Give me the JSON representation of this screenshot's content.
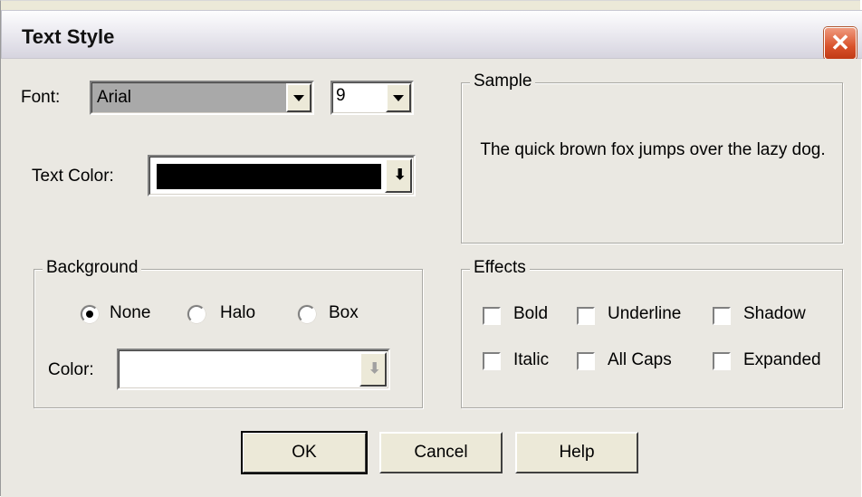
{
  "window": {
    "title": "Text Style",
    "close_glyph": "✕"
  },
  "font": {
    "label": "Font:",
    "value": "Arial",
    "size_value": "9"
  },
  "text_color": {
    "label": "Text Color:",
    "value_color": "#000000"
  },
  "sample": {
    "title": "Sample",
    "text": "The quick brown fox jumps over the lazy dog."
  },
  "background": {
    "title": "Background",
    "options": [
      "None",
      "Halo",
      "Box"
    ],
    "selected": "None",
    "color_label": "Color:"
  },
  "effects": {
    "title": "Effects",
    "items": [
      "Bold",
      "Underline",
      "Shadow",
      "Italic",
      "All Caps",
      "Expanded"
    ]
  },
  "buttons": {
    "ok": "OK",
    "cancel": "Cancel",
    "help": "Help"
  }
}
